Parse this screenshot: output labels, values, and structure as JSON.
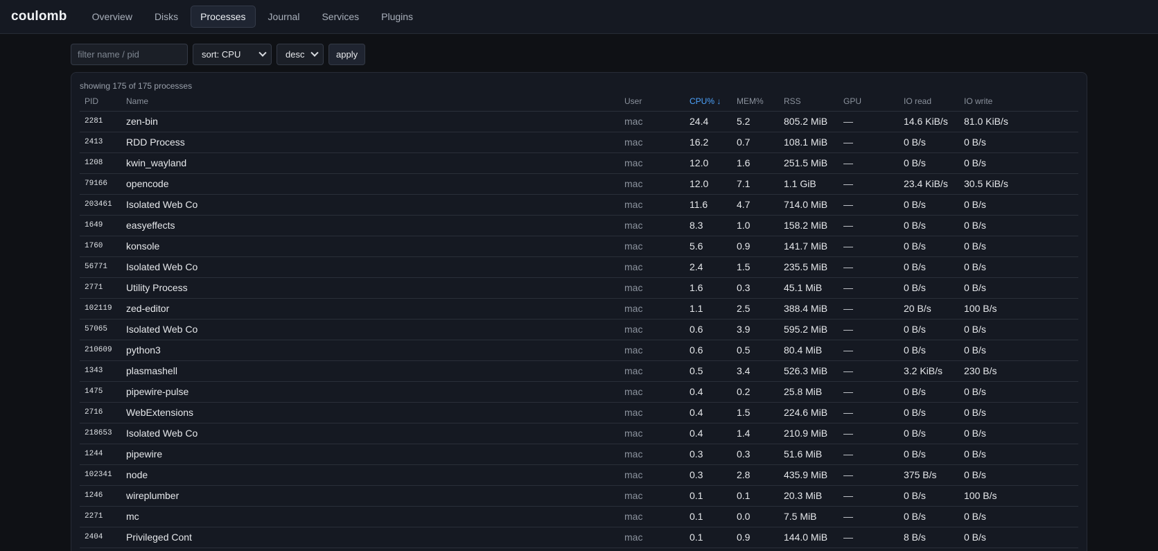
{
  "app": {
    "brand": "coulomb"
  },
  "nav": [
    {
      "label": "Overview",
      "active": false
    },
    {
      "label": "Disks",
      "active": false
    },
    {
      "label": "Processes",
      "active": true
    },
    {
      "label": "Journal",
      "active": false
    },
    {
      "label": "Services",
      "active": false
    },
    {
      "label": "Plugins",
      "active": false
    }
  ],
  "controls": {
    "filter_placeholder": "filter name / pid",
    "sort_value": "sort: CPU",
    "order_value": "desc",
    "apply_label": "apply"
  },
  "summary": "showing 175 of 175 processes",
  "accent_color": "#4ea5ff",
  "columns": [
    "PID",
    "Name",
    "User",
    "CPU% ↓",
    "MEM%",
    "RSS",
    "GPU",
    "IO read",
    "IO write"
  ],
  "rows": [
    [
      "2281",
      "zen-bin",
      "mac",
      "24.4",
      "5.2",
      "805.2 MiB",
      "—",
      "14.6 KiB/s",
      "81.0 KiB/s"
    ],
    [
      "2413",
      "RDD Process",
      "mac",
      "16.2",
      "0.7",
      "108.1 MiB",
      "—",
      "0 B/s",
      "0 B/s"
    ],
    [
      "1208",
      "kwin_wayland",
      "mac",
      "12.0",
      "1.6",
      "251.5 MiB",
      "—",
      "0 B/s",
      "0 B/s"
    ],
    [
      "79166",
      "opencode",
      "mac",
      "12.0",
      "7.1",
      "1.1 GiB",
      "—",
      "23.4 KiB/s",
      "30.5 KiB/s"
    ],
    [
      "203461",
      "Isolated Web Co",
      "mac",
      "11.6",
      "4.7",
      "714.0 MiB",
      "—",
      "0 B/s",
      "0 B/s"
    ],
    [
      "1649",
      "easyeffects",
      "mac",
      "8.3",
      "1.0",
      "158.2 MiB",
      "—",
      "0 B/s",
      "0 B/s"
    ],
    [
      "1760",
      "konsole",
      "mac",
      "5.6",
      "0.9",
      "141.7 MiB",
      "—",
      "0 B/s",
      "0 B/s"
    ],
    [
      "56771",
      "Isolated Web Co",
      "mac",
      "2.4",
      "1.5",
      "235.5 MiB",
      "—",
      "0 B/s",
      "0 B/s"
    ],
    [
      "2771",
      "Utility Process",
      "mac",
      "1.6",
      "0.3",
      "45.1 MiB",
      "—",
      "0 B/s",
      "0 B/s"
    ],
    [
      "102119",
      "zed-editor",
      "mac",
      "1.1",
      "2.5",
      "388.4 MiB",
      "—",
      "20 B/s",
      "100 B/s"
    ],
    [
      "57065",
      "Isolated Web Co",
      "mac",
      "0.6",
      "3.9",
      "595.2 MiB",
      "—",
      "0 B/s",
      "0 B/s"
    ],
    [
      "210609",
      "python3",
      "mac",
      "0.6",
      "0.5",
      "80.4 MiB",
      "—",
      "0 B/s",
      "0 B/s"
    ],
    [
      "1343",
      "plasmashell",
      "mac",
      "0.5",
      "3.4",
      "526.3 MiB",
      "—",
      "3.2 KiB/s",
      "230 B/s"
    ],
    [
      "1475",
      "pipewire-pulse",
      "mac",
      "0.4",
      "0.2",
      "25.8 MiB",
      "—",
      "0 B/s",
      "0 B/s"
    ],
    [
      "2716",
      "WebExtensions",
      "mac",
      "0.4",
      "1.5",
      "224.6 MiB",
      "—",
      "0 B/s",
      "0 B/s"
    ],
    [
      "218653",
      "Isolated Web Co",
      "mac",
      "0.4",
      "1.4",
      "210.9 MiB",
      "—",
      "0 B/s",
      "0 B/s"
    ],
    [
      "1244",
      "pipewire",
      "mac",
      "0.3",
      "0.3",
      "51.6 MiB",
      "—",
      "0 B/s",
      "0 B/s"
    ],
    [
      "102341",
      "node",
      "mac",
      "0.3",
      "2.8",
      "435.9 MiB",
      "—",
      "375 B/s",
      "0 B/s"
    ],
    [
      "1246",
      "wireplumber",
      "mac",
      "0.1",
      "0.1",
      "20.3 MiB",
      "—",
      "0 B/s",
      "100 B/s"
    ],
    [
      "2271",
      "mc",
      "mac",
      "0.1",
      "0.0",
      "7.5 MiB",
      "—",
      "0 B/s",
      "0 B/s"
    ],
    [
      "2404",
      "Privileged Cont",
      "mac",
      "0.1",
      "0.9",
      "144.0 MiB",
      "—",
      "8 B/s",
      "0 B/s"
    ]
  ]
}
